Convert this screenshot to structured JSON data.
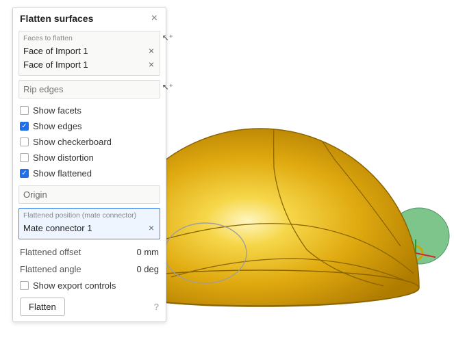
{
  "panel": {
    "title": "Flatten surfaces",
    "faces": {
      "label": "Faces to flatten",
      "items": [
        {
          "label": "Face of Import 1"
        },
        {
          "label": "Face of Import 1"
        }
      ]
    },
    "rip_edges_placeholder": "Rip edges",
    "checks": {
      "show_facets": "Show facets",
      "show_edges": "Show edges",
      "show_checkerboard": "Show checkerboard",
      "show_distortion": "Show distortion",
      "show_flattened": "Show flattened",
      "show_export_controls": "Show export controls"
    },
    "checked": {
      "show_facets": false,
      "show_edges": true,
      "show_checkerboard": false,
      "show_distortion": false,
      "show_flattened": true,
      "show_export_controls": false
    },
    "origin_placeholder": "Origin",
    "flattened_position": {
      "label": "Flattened position (mate connector)",
      "value": "Mate connector 1"
    },
    "flattened_offset": {
      "label": "Flattened offset",
      "value": "0 mm"
    },
    "flattened_angle": {
      "label": "Flattened angle",
      "value": "0 deg"
    },
    "flatten_button": "Flatten"
  },
  "colors": {
    "dome": "#e6b800",
    "dome_dark": "#b38600",
    "dome_hilite": "#fff2a8",
    "flat_preview": "#6fbf7f",
    "edges": "#8a6500"
  }
}
